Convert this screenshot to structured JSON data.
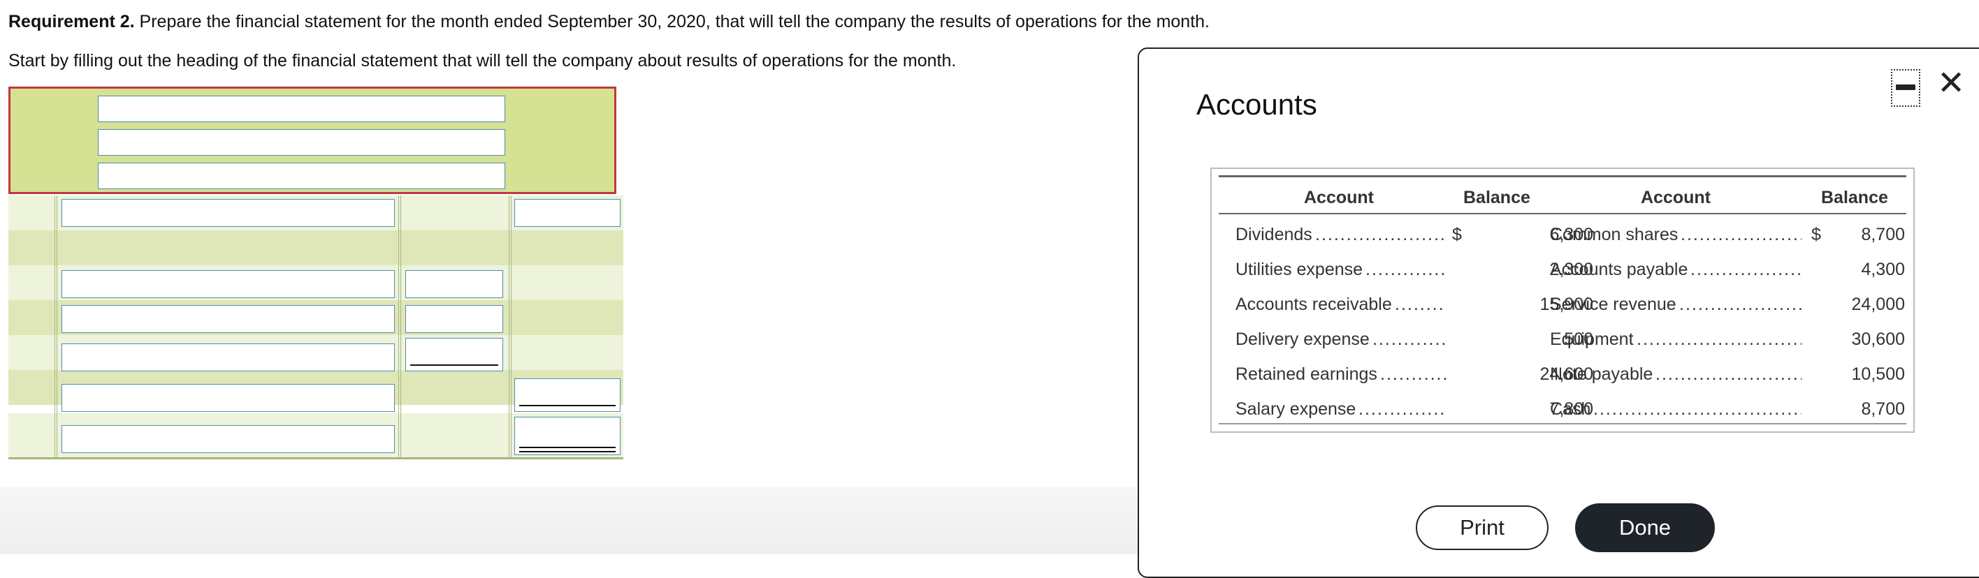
{
  "instructions": {
    "requirement_label": "Requirement 2.",
    "requirement_text": " Prepare the financial statement for the month ended September 30, 2020, that will tell the company the results of operations for the month.",
    "start_text": "Start by filling out the heading of the financial statement that will tell the company about results of operations for the month."
  },
  "popup": {
    "title": "Accounts",
    "print_label": "Print",
    "done_label": "Done",
    "close_glyph": "✕",
    "table": {
      "headers": [
        "Account",
        "Balance",
        "Account",
        "Balance"
      ],
      "currency": "$",
      "rows": [
        {
          "left_account": "Dividends",
          "left_balance": "6,300",
          "right_account": "Common shares",
          "right_balance": "8,700"
        },
        {
          "left_account": "Utilities expense",
          "left_balance": "2,300",
          "right_account": "Accounts payable",
          "right_balance": "4,300"
        },
        {
          "left_account": "Accounts receivable",
          "left_balance": "15,900",
          "right_account": "Service revenue",
          "right_balance": "24,000"
        },
        {
          "left_account": "Delivery expense",
          "left_balance": "500",
          "right_account": "Equipment",
          "right_balance": "30,600"
        },
        {
          "left_account": "Retained earnings",
          "left_balance": "24,600",
          "right_account": "Note payable",
          "right_balance": "10,500"
        },
        {
          "left_account": "Salary expense",
          "left_balance": "7,800",
          "right_account": "Cash",
          "right_balance": "8,700"
        }
      ]
    }
  },
  "colors": {
    "heading_fill": "#d5e193",
    "heading_border": "#c0393b",
    "input_border": "#4f8fa8",
    "row_light": "#eef3dc",
    "row_dark": "#dfe7b8",
    "done_button": "#1f242b"
  }
}
